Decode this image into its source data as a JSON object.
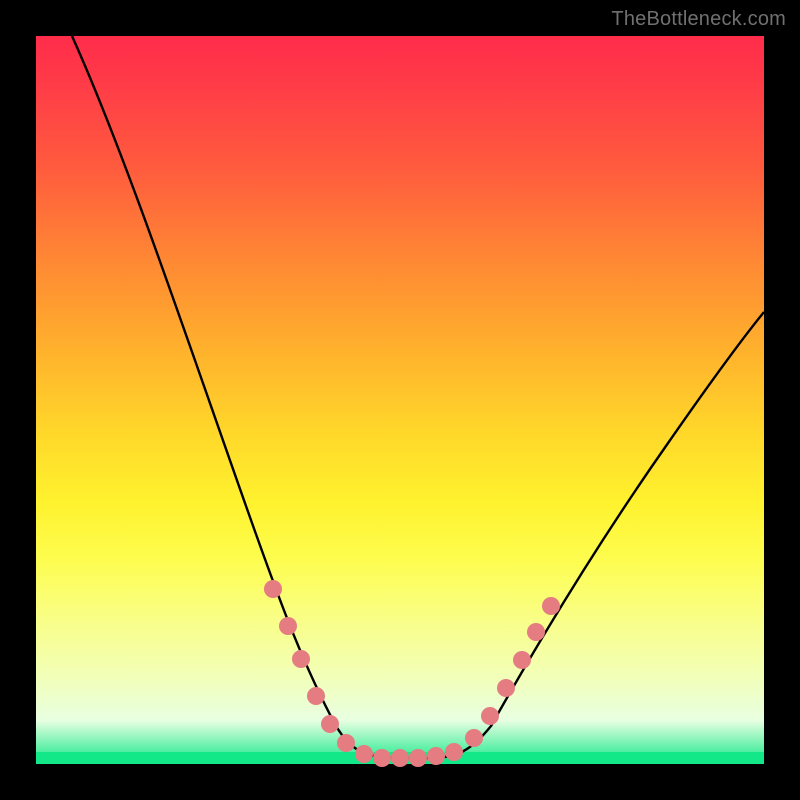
{
  "watermark": "TheBottleneck.com",
  "chart_data": {
    "type": "line",
    "title": "",
    "xlabel": "",
    "ylabel": "",
    "xlim": [
      0,
      100
    ],
    "ylim": [
      0,
      100
    ],
    "grid": false,
    "series": [
      {
        "name": "bottleneck-curve",
        "color": "#000000",
        "x": [
          5,
          10,
          15,
          20,
          25,
          28,
          30,
          32,
          34,
          36,
          38,
          40,
          42,
          44,
          46,
          48,
          50,
          52,
          55,
          60,
          65,
          70,
          75,
          80,
          85,
          90,
          95,
          100
        ],
        "y": [
          100,
          88,
          75,
          62,
          48,
          40,
          34,
          28,
          22,
          16,
          10,
          6,
          3,
          1.5,
          1,
          1,
          1,
          1,
          1.5,
          4,
          8,
          14,
          22,
          30,
          38,
          45,
          52,
          58
        ]
      }
    ],
    "markers": {
      "name": "highlight-points",
      "color": "#e47c81",
      "x": [
        30,
        32,
        34,
        36,
        38,
        40,
        42,
        44,
        46,
        48,
        50,
        52,
        55,
        57,
        59,
        61,
        63,
        65
      ],
      "y": [
        34,
        28,
        22,
        16,
        10,
        6,
        3,
        1.5,
        1,
        1,
        1,
        1,
        1.5,
        3,
        6,
        10,
        16,
        22
      ]
    },
    "background_gradient": {
      "top": "#ff2c4a",
      "bottom": "#13e889",
      "description": "vertical red-to-green rainbow gradient"
    }
  }
}
